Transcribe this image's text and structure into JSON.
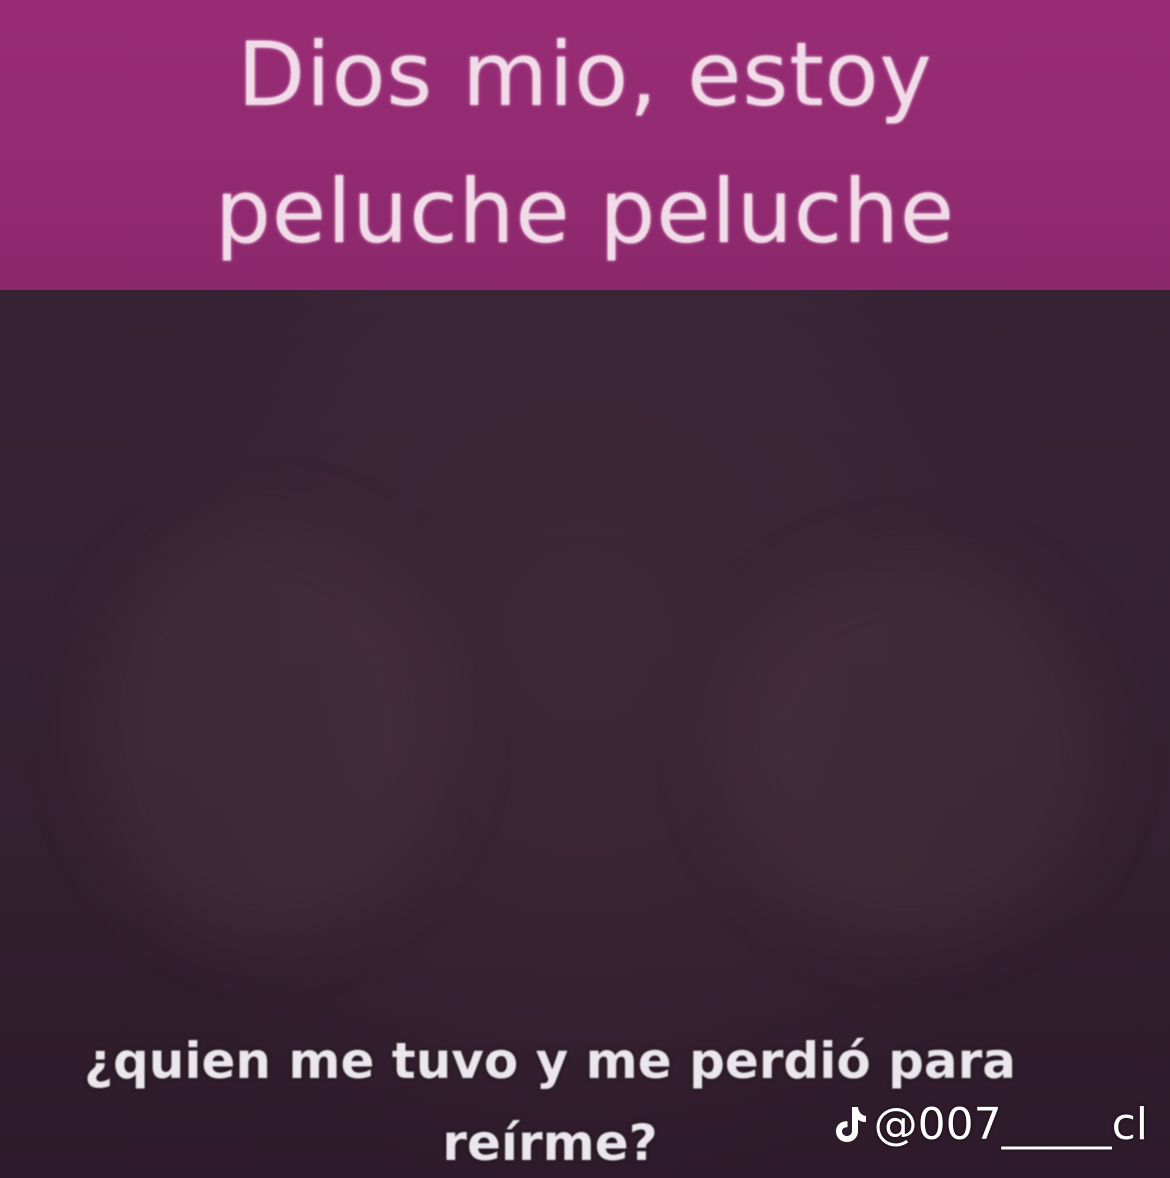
{
  "meme": {
    "top_caption_line1": "Dios mio, estoy",
    "top_caption_line2": "peluche peluche",
    "bottom_caption_line1": "¿quien me tuvo y me perdió para",
    "bottom_caption_line2": "reírme?"
  },
  "watermark": {
    "icon": "tiktok-logo-icon",
    "handle": "@007_____cl"
  },
  "colors": {
    "banner": "#962b73",
    "background": "#33202f",
    "top_text": "#f2dbe9",
    "bottom_text": "#ece7ec"
  }
}
